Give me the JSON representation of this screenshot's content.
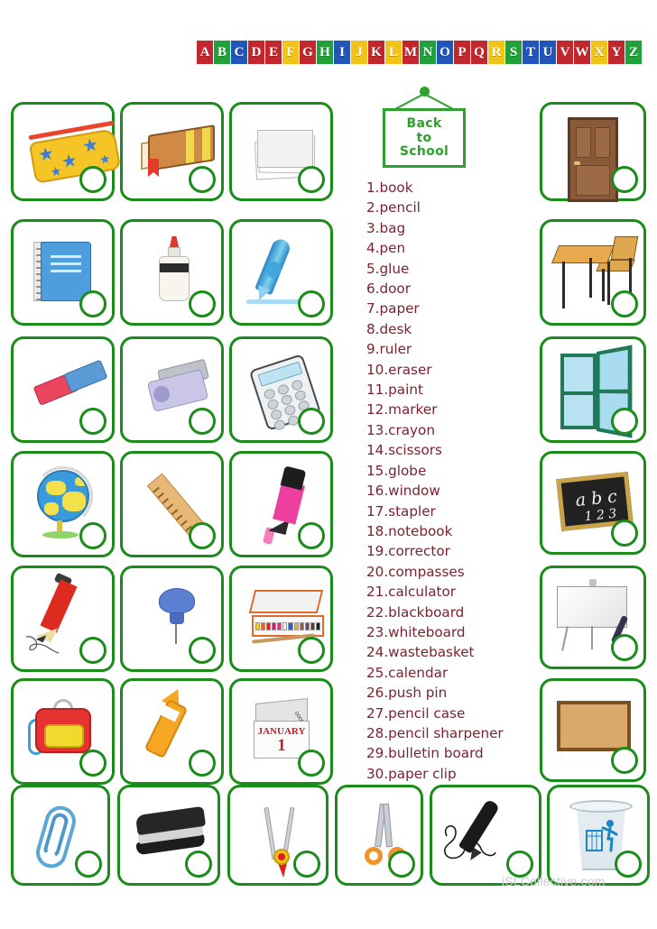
{
  "worksheet": {
    "title": "Back to School",
    "sign": {
      "line1": "Back",
      "line2": "to",
      "line3": "School"
    },
    "watermark": "iSLCollective.com"
  },
  "alphabet": {
    "letters": [
      {
        "letter": "A",
        "color": "#c1272d"
      },
      {
        "letter": "B",
        "color": "#22a03a"
      },
      {
        "letter": "C",
        "color": "#2255b8"
      },
      {
        "letter": "D",
        "color": "#c1272d"
      },
      {
        "letter": "E",
        "color": "#c1272d"
      },
      {
        "letter": "F",
        "color": "#f2c318"
      },
      {
        "letter": "G",
        "color": "#c1272d"
      },
      {
        "letter": "H",
        "color": "#22a03a"
      },
      {
        "letter": "I",
        "color": "#2255b8"
      },
      {
        "letter": "J",
        "color": "#f2c318"
      },
      {
        "letter": "K",
        "color": "#c1272d"
      },
      {
        "letter": "L",
        "color": "#f2c318"
      },
      {
        "letter": "M",
        "color": "#c1272d"
      },
      {
        "letter": "N",
        "color": "#22a03a"
      },
      {
        "letter": "O",
        "color": "#2255b8"
      },
      {
        "letter": "P",
        "color": "#c1272d"
      },
      {
        "letter": "Q",
        "color": "#c1272d"
      },
      {
        "letter": "R",
        "color": "#f2c318"
      },
      {
        "letter": "S",
        "color": "#22a03a"
      },
      {
        "letter": "T",
        "color": "#2255b8"
      },
      {
        "letter": "U",
        "color": "#2255b8"
      },
      {
        "letter": "V",
        "color": "#c1272d"
      },
      {
        "letter": "W",
        "color": "#c1272d"
      },
      {
        "letter": "X",
        "color": "#f2c318"
      },
      {
        "letter": "Y",
        "color": "#c1272d"
      },
      {
        "letter": "Z",
        "color": "#22a03a"
      }
    ]
  },
  "word_list": [
    "1.book",
    "2.pencil",
    "3.bag",
    "4.pen",
    "5.glue",
    "6.door",
    "7.paper",
    "8.desk",
    "9.ruler",
    "10.eraser",
    "11.paint",
    "12.marker",
    "13.crayon",
    "14.scissors",
    "15.globe",
    "16.window",
    "17.stapler",
    "18.notebook",
    "19.corrector",
    "20.compasses",
    "21.calculator",
    "22.blackboard",
    "23.whiteboard",
    "24.wastebasket",
    "25.calendar",
    "26.push pin",
    "27.pencil case",
    "28.pencil sharpener",
    "29.bulletin board",
    "30.paper clip"
  ],
  "picture_cards": [
    {
      "id": "pencil-case",
      "label": "pencil case"
    },
    {
      "id": "book",
      "label": "book"
    },
    {
      "id": "paper",
      "label": "paper"
    },
    {
      "id": "door",
      "label": "door"
    },
    {
      "id": "notebook",
      "label": "notebook"
    },
    {
      "id": "glue",
      "label": "glue"
    },
    {
      "id": "pen",
      "label": "pen"
    },
    {
      "id": "desk",
      "label": "desk"
    },
    {
      "id": "eraser",
      "label": "eraser"
    },
    {
      "id": "pencil-sharpener",
      "label": "pencil sharpener"
    },
    {
      "id": "calculator",
      "label": "calculator"
    },
    {
      "id": "window",
      "label": "window"
    },
    {
      "id": "globe",
      "label": "globe"
    },
    {
      "id": "ruler",
      "label": "ruler"
    },
    {
      "id": "marker",
      "label": "marker"
    },
    {
      "id": "blackboard",
      "label": "blackboard"
    },
    {
      "id": "pencil",
      "label": "pencil"
    },
    {
      "id": "push-pin",
      "label": "push pin"
    },
    {
      "id": "paint",
      "label": "paint"
    },
    {
      "id": "whiteboard",
      "label": "whiteboard"
    },
    {
      "id": "bag",
      "label": "bag"
    },
    {
      "id": "crayon",
      "label": "crayon"
    },
    {
      "id": "calendar",
      "label": "calendar"
    },
    {
      "id": "bulletin-board",
      "label": "bulletin board"
    },
    {
      "id": "paper-clip",
      "label": "paper clip"
    },
    {
      "id": "stapler",
      "label": "stapler"
    },
    {
      "id": "compasses",
      "label": "compasses"
    },
    {
      "id": "scissors",
      "label": "scissors"
    },
    {
      "id": "corrector",
      "label": "corrector"
    },
    {
      "id": "wastebasket",
      "label": "wastebasket"
    }
  ],
  "card_art_text": {
    "calendar_month": "JANUARY",
    "calendar_day": "1",
    "blackboard_letters": "a b c",
    "blackboard_numbers": "1 2 3"
  },
  "colors": {
    "card_border": "#1a8c1a",
    "word_text": "#7c2230",
    "sign_green": "#2ea02e",
    "watermark": "#c9c9c9"
  }
}
